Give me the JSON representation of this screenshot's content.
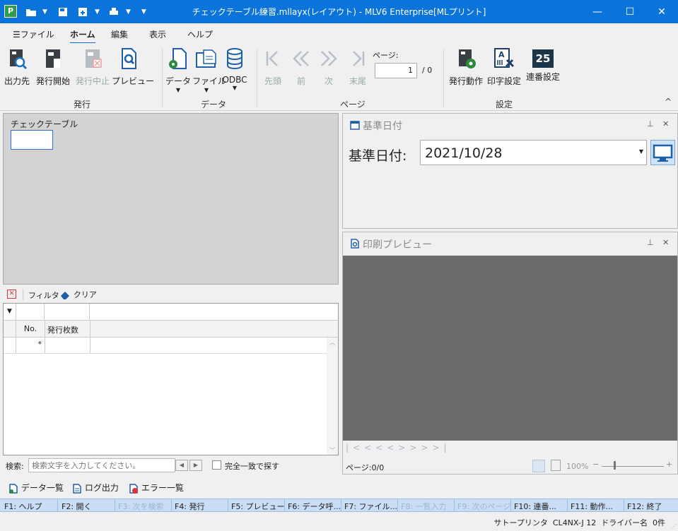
{
  "titlebar": {
    "title": "チェックテーブル練習.mllayx(レイアウト) - MLV6 Enterprise[MLプリント]",
    "minimize": "—",
    "maximize": "☐",
    "close": "✕",
    "app_icon_letter": "P"
  },
  "menu": {
    "file": "ファイル",
    "home": "ホーム",
    "edit": "編集",
    "view": "表示",
    "help": "ヘルプ"
  },
  "ribbon": {
    "output_dest": "出力先",
    "start_issue": "発行開始",
    "stop_issue": "発行中止",
    "preview": "プレビュー",
    "group_issue": "発行",
    "data": "データ",
    "file": "ファイル",
    "odbc": "ODBC",
    "group_data": "データ",
    "first": "先頭",
    "prev": "前",
    "next": "次",
    "last": "末尾",
    "page_label": "ページ:",
    "page_value": "1",
    "page_total": "/ 0",
    "group_page": "ページ",
    "issue_action": "発行動作",
    "print_settings": "印字設定",
    "serial_settings": "連番設定",
    "group_settings": "設定",
    "serial_icon_text": "25",
    "collapse": "^"
  },
  "left_panel": {
    "title": "チェックテーブル"
  },
  "filterbar": {
    "filter": "フィルタ",
    "clear": "クリア"
  },
  "grid": {
    "headers": [
      "No.",
      "発行枚数"
    ],
    "new_row_marker": "*"
  },
  "search": {
    "label": "検索:",
    "placeholder": "検索文字を入力してください。",
    "exact_match": "完全一致で探す"
  },
  "date_pane": {
    "title": "基準日付",
    "label": "基準日付:",
    "value": "2021/10/28"
  },
  "preview_pane": {
    "title": "印刷プレビュー",
    "page": "ページ:0/0",
    "zoom": "100%"
  },
  "bottom_links": {
    "data_list": "データ一覧",
    "log_output": "ログ出力",
    "error_list": "エラー一覧"
  },
  "fkeys": [
    "F1: ヘルプ",
    "F2: 開く",
    "F3: 次を検索",
    "F4: 発行",
    "F5: プレビュー",
    "F6: データ呼...",
    "F7: ファイル...",
    "F8: 一覧入力",
    "F9: 次のページ",
    "F10: 連番...",
    "F11: 動作...",
    "F12: 終了"
  ],
  "status": {
    "text": "サトープリンタ  CL4NX-J 12  ドライバー名  0件"
  }
}
